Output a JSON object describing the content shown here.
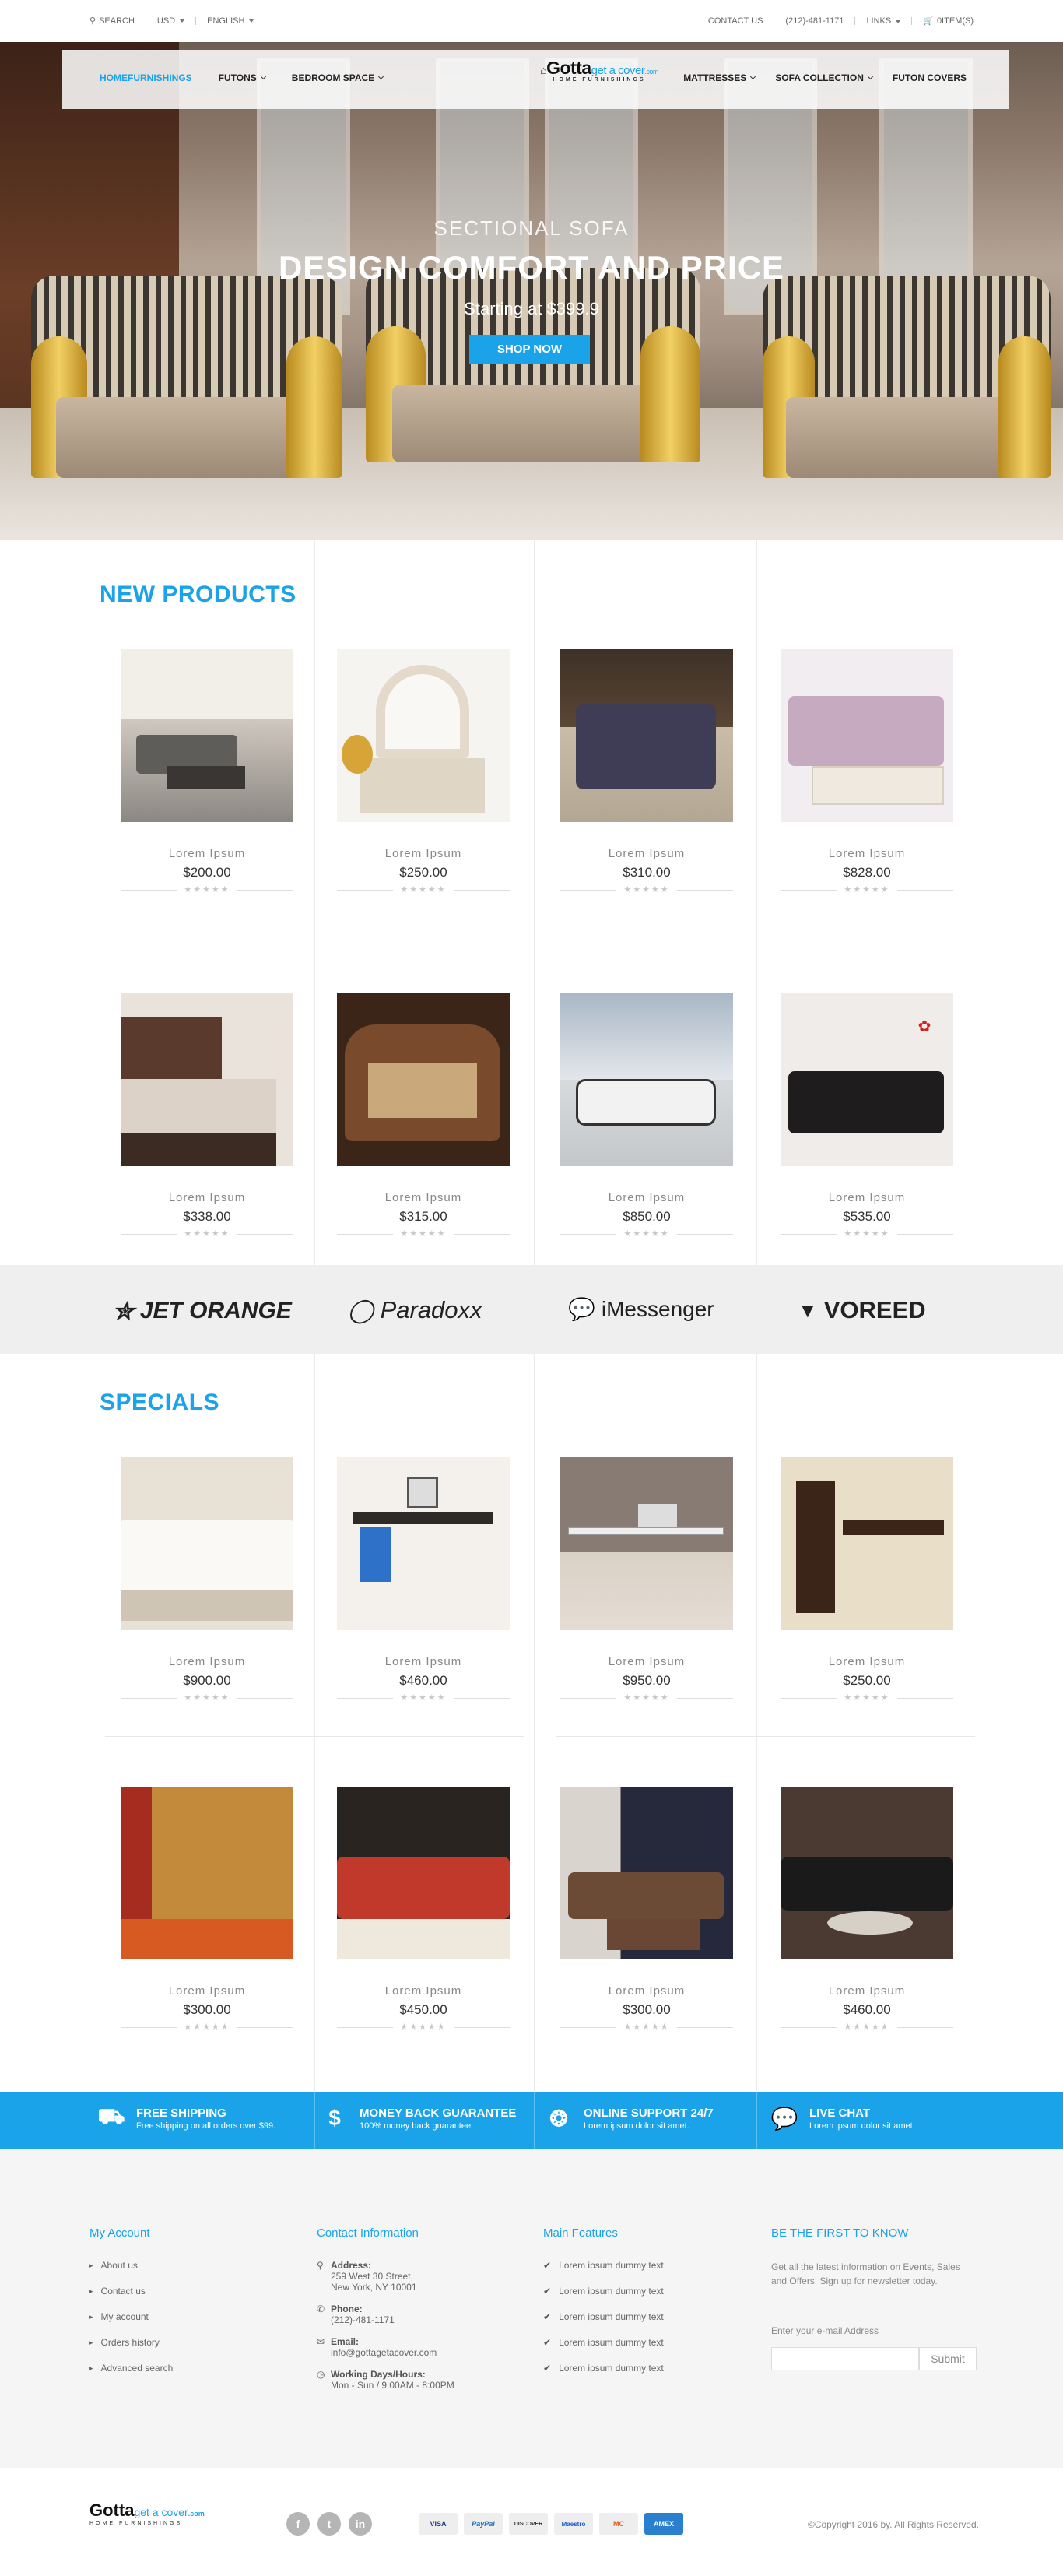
{
  "topbar": {
    "search": "SEARCH",
    "currency": "USD",
    "language": "ENGLISH",
    "contact": "CONTACT US",
    "phone": "(212)-481-1171",
    "links": "LINKS",
    "cart": "0ITEM(S)"
  },
  "nav": {
    "left": [
      "HOMEFURNISHINGS",
      "FUTONS",
      "BEDROOM SPACE"
    ],
    "right": [
      "MATTRESSES",
      "SOFA COLLECTION",
      "FUTON COVERS"
    ],
    "active_color": "#1aa3e8"
  },
  "logo": {
    "main": "Gotta",
    "accent": "get a cover",
    "suffix": ".com",
    "tagline": "HOME FURNISHINGS"
  },
  "hero": {
    "kicker": "SECTIONAL SOFA",
    "title": "DESIGN COMFORT AND PRICE",
    "subtitle": "Starting at $399.9",
    "button": "SHOP NOW"
  },
  "new_products": {
    "title": "NEW PRODUCTS",
    "items": [
      {
        "name": "Lorem  Ipsum",
        "price": "$200.00",
        "stars": "★★★★★"
      },
      {
        "name": "Lorem  Ipsum",
        "price": "$250.00",
        "stars": "★★★★★"
      },
      {
        "name": "Lorem  Ipsum",
        "price": "$310.00",
        "stars": "★★★★★"
      },
      {
        "name": "Lorem  Ipsum",
        "price": "$828.00",
        "stars": "★★★★★"
      },
      {
        "name": "Lorem  Ipsum",
        "price": "$338.00",
        "stars": "★★★★★"
      },
      {
        "name": "Lorem  Ipsum",
        "price": "$315.00",
        "stars": "★★★★★"
      },
      {
        "name": "Lorem  Ipsum",
        "price": "$850.00",
        "stars": "★★★★★"
      },
      {
        "name": "Lorem  Ipsum",
        "price": "$535.00",
        "stars": "★★★★★"
      }
    ]
  },
  "brands": [
    "JET ORANGE",
    "Paradoxx",
    "iMessenger",
    "VOREED"
  ],
  "specials": {
    "title": "SPECIALS",
    "items": [
      {
        "name": "Lorem  Ipsum",
        "price": "$900.00",
        "stars": "★★★★★"
      },
      {
        "name": "Lorem  Ipsum",
        "price": "$460.00",
        "stars": "★★★★★"
      },
      {
        "name": "Lorem  Ipsum",
        "price": "$950.00",
        "stars": "★★★★★"
      },
      {
        "name": "Lorem  Ipsum",
        "price": "$250.00",
        "stars": "★★★★★"
      },
      {
        "name": "Lorem  Ipsum",
        "price": "$300.00",
        "stars": "★★★★★"
      },
      {
        "name": "Lorem  Ipsum",
        "price": "$450.00",
        "stars": "★★★★★"
      },
      {
        "name": "Lorem  Ipsum",
        "price": "$300.00",
        "stars": "★★★★★"
      },
      {
        "name": "Lorem  Ipsum",
        "price": "$460.00",
        "stars": "★★★★★"
      }
    ]
  },
  "features": [
    {
      "title": "FREE SHIPPING",
      "text": "Free shipping on all orders over $99.",
      "icon": "truck-icon"
    },
    {
      "title": "MONEY BACK GUARANTEE",
      "text": "100% money back guarantee",
      "icon": "dollar-icon"
    },
    {
      "title": "ONLINE SUPPORT 24/7",
      "text": "Lorem ipsum dolor sit amet.",
      "icon": "lifebuoy-icon"
    },
    {
      "title": "LIVE CHAT",
      "text": "Lorem ipsum dolor sit amet.",
      "icon": "chat-icon"
    }
  ],
  "footer": {
    "account": {
      "title": "My Account",
      "links": [
        "About us",
        "Contact us",
        "My account",
        "Orders history",
        "Advanced search"
      ]
    },
    "contact": {
      "title": "Contact Information",
      "address_label": "Address:",
      "address_1": "259 West 30 Street,",
      "address_2": "New York, NY 10001",
      "phone_label": "Phone:",
      "phone": "(212)-481-1171",
      "email_label": "Email:",
      "email": "info@gottagetacover.com",
      "hours_label": "Working Days/Hours:",
      "hours": "Mon - Sun / 9:00AM - 8:00PM"
    },
    "features": {
      "title": "Main Features",
      "items": [
        "Lorem ipsum dummy text",
        "Lorem ipsum dummy text",
        "Lorem ipsum dummy text",
        "Lorem ipsum dummy text",
        "Lorem ipsum dummy text"
      ]
    },
    "newsletter": {
      "title": "BE THE FIRST TO KNOW",
      "text": "Get all the latest information on Events, Sales and Offers. Sign up for newsletter today.",
      "label": "Enter your e-mail Address",
      "button": "Submit"
    }
  },
  "bottom": {
    "social": [
      "f",
      "t",
      "in"
    ],
    "payments": [
      "VISA",
      "PayPal",
      "DISCOVER",
      "Maestro",
      "MC",
      "AMEX"
    ],
    "copyright": "©Copyright 2016 by. All Rights Reserved."
  }
}
